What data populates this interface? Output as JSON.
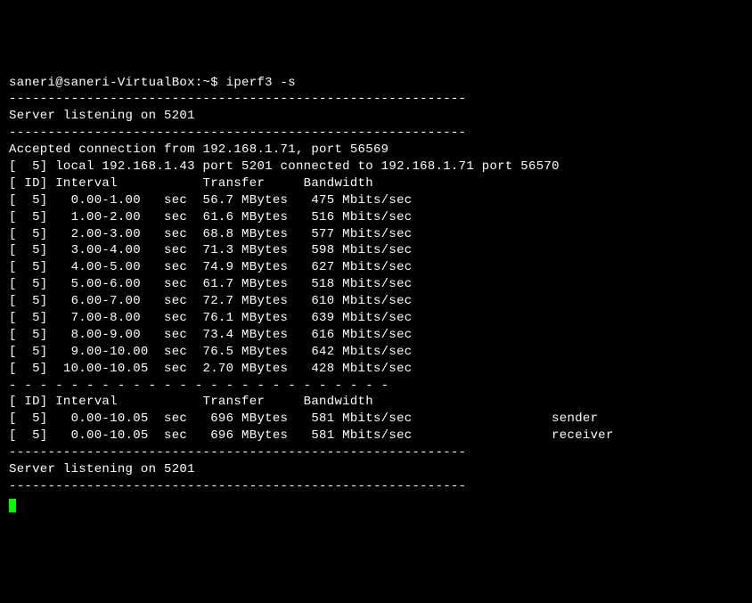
{
  "prompt": "saneri@saneri-VirtualBox:~$ iperf3 -s",
  "separator_full": "-----------------------------------------------------------",
  "separator_dashes": "- - - - - - - - - - - - - - - - - - - - - - - - -",
  "listening_msg": "Server listening on 5201",
  "accepted_msg": "Accepted connection from 192.168.1.71, port 56569",
  "connection_msg": "[  5] local 192.168.1.43 port 5201 connected to 192.168.1.71 port 56570",
  "header_line": "[ ID] Interval           Transfer     Bandwidth",
  "rows": [
    "[  5]   0.00-1.00   sec  56.7 MBytes   475 Mbits/sec",
    "[  5]   1.00-2.00   sec  61.6 MBytes   516 Mbits/sec",
    "[  5]   2.00-3.00   sec  68.8 MBytes   577 Mbits/sec",
    "[  5]   3.00-4.00   sec  71.3 MBytes   598 Mbits/sec",
    "[  5]   4.00-5.00   sec  74.9 MBytes   627 Mbits/sec",
    "[  5]   5.00-6.00   sec  61.7 MBytes   518 Mbits/sec",
    "[  5]   6.00-7.00   sec  72.7 MBytes   610 Mbits/sec",
    "[  5]   7.00-8.00   sec  76.1 MBytes   639 Mbits/sec",
    "[  5]   8.00-9.00   sec  73.4 MBytes   616 Mbits/sec",
    "[  5]   9.00-10.00  sec  76.5 MBytes   642 Mbits/sec",
    "[  5]  10.00-10.05  sec  2.70 MBytes   428 Mbits/sec"
  ],
  "summary_rows": [
    "[  5]   0.00-10.05  sec   696 MBytes   581 Mbits/sec                  sender",
    "[  5]   0.00-10.05  sec   696 MBytes   581 Mbits/sec                  receiver"
  ]
}
